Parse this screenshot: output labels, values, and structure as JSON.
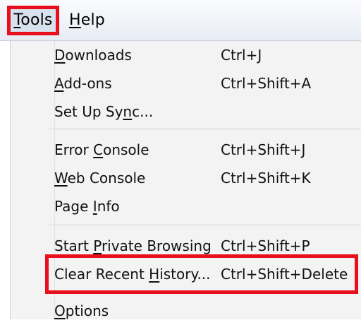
{
  "menubar": {
    "tools": {
      "mnemonic": "T",
      "rest": "ools"
    },
    "help": {
      "mnemonic": "H",
      "rest": "elp"
    }
  },
  "menu": {
    "items": [
      {
        "pre": "",
        "mn": "D",
        "post": "ownloads",
        "shortcut": "Ctrl+J"
      },
      {
        "pre": "",
        "mn": "A",
        "post": "dd-ons",
        "shortcut": "Ctrl+Shift+A"
      },
      {
        "pre": "Set Up Sy",
        "mn": "n",
        "post": "c...",
        "shortcut": ""
      },
      {
        "pre": "Error ",
        "mn": "C",
        "post": "onsole",
        "shortcut": "Ctrl+Shift+J"
      },
      {
        "pre": "",
        "mn": "W",
        "post": "eb Console",
        "shortcut": "Ctrl+Shift+K"
      },
      {
        "pre": "Page ",
        "mn": "I",
        "post": "nfo",
        "shortcut": ""
      },
      {
        "pre": "Start ",
        "mn": "P",
        "post": "rivate Browsing",
        "shortcut": "Ctrl+Shift+P"
      },
      {
        "pre": "Clear Recent ",
        "mn": "H",
        "post": "istory...",
        "shortcut": "Ctrl+Shift+Delete"
      },
      {
        "pre": "",
        "mn": "O",
        "post": "ptions",
        "shortcut": ""
      }
    ]
  },
  "colors": {
    "highlight": "#e8101c",
    "menubar_bg": "#e7ecf4",
    "menu_bg": "#f3f3f3"
  }
}
